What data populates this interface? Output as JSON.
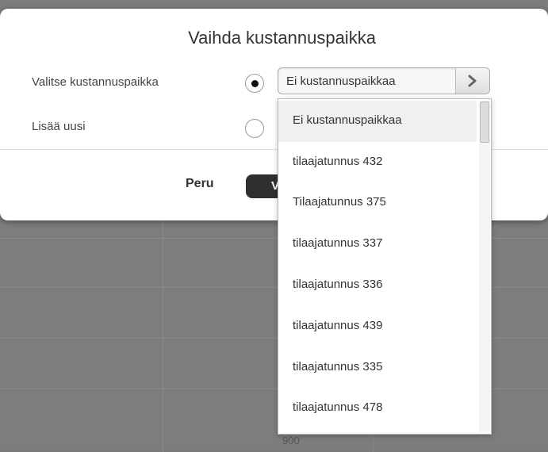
{
  "dialog": {
    "title": "Vaihda kustannuspaikka",
    "select_label": "Valitse kustannuspaikka",
    "add_new_label": "Lisää uusi",
    "selected_value": "Ei kustannuspaikkaa",
    "cancel_label": "Peru",
    "confirm_label_partial": "V"
  },
  "dropdown": {
    "options": [
      "Ei kustannuspaikkaa",
      "tilaajatunnus 432",
      "Tilaajatunnus 375",
      "tilaajatunnus 337",
      "tilaajatunnus 336",
      "tilaajatunnus 439",
      "tilaajatunnus 335",
      "tilaajatunnus 478"
    ]
  },
  "background": {
    "partial_value": "900"
  },
  "icons": {
    "select_arrow": "chevron-right-icon"
  }
}
